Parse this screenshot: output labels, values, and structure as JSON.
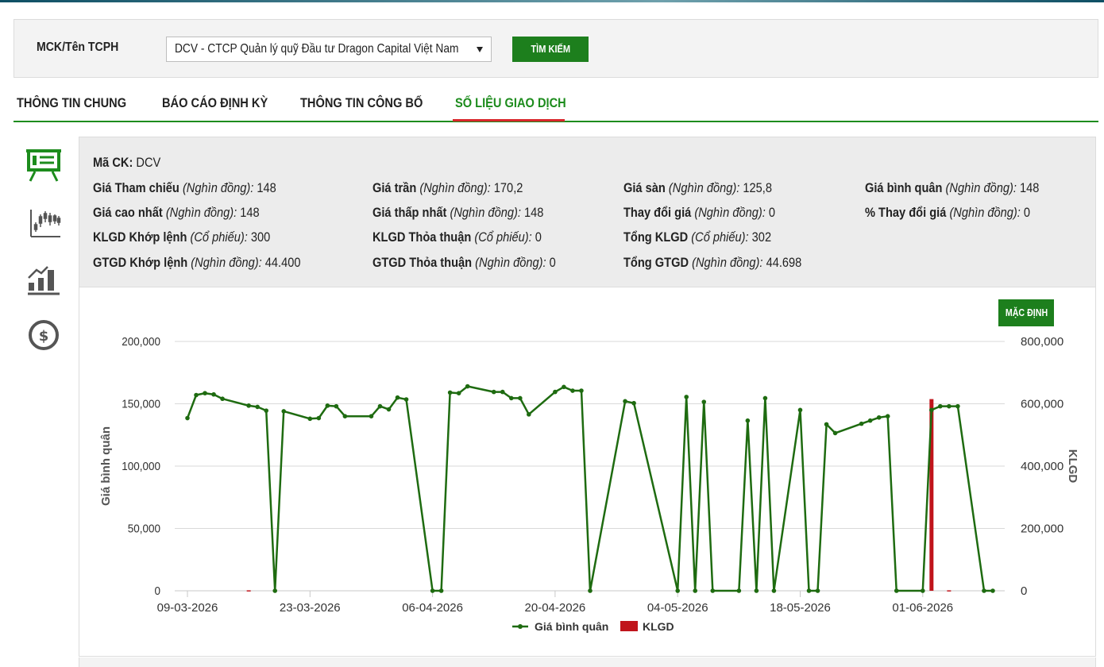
{
  "search": {
    "label": "MCK/Tên TCPH",
    "selected": "DCV - CTCP Quản lý quỹ Đầu tư Dragon Capital Việt Nam",
    "button": "TÌM KIẾM"
  },
  "tabs": [
    {
      "label": "THÔNG TIN CHUNG",
      "active": false
    },
    {
      "label": "BÁO CÁO ĐỊNH KỲ",
      "active": false
    },
    {
      "label": "THÔNG TIN CÔNG BỐ",
      "active": false
    },
    {
      "label": "SỐ LIỆU GIAO DỊCH",
      "active": true
    }
  ],
  "side_icons": [
    "presentation-icon",
    "candlestick-chart-icon",
    "bar-growth-icon",
    "dollar-coin-icon"
  ],
  "colors": {
    "accent": "#1d8c1d",
    "active_tab_underline": "#d9262b",
    "line": "#1e6b10",
    "volume": "#c0141b"
  },
  "info": {
    "code_label": "Mã CK:",
    "code_value": "DCV",
    "rows": [
      [
        {
          "label": "Giá Tham chiếu",
          "unit": "(Nghìn đồng):",
          "value": "148"
        },
        {
          "label": "Giá trần",
          "unit": "(Nghìn đồng):",
          "value": "170,2"
        },
        {
          "label": "Giá sàn",
          "unit": "(Nghìn đồng):",
          "value": "125,8"
        },
        {
          "label": "Giá bình quân",
          "unit": "(Nghìn đồng):",
          "value": "148"
        }
      ],
      [
        {
          "label": "Giá cao nhất",
          "unit": "(Nghìn đồng):",
          "value": "148"
        },
        {
          "label": "Giá thấp nhất",
          "unit": "(Nghìn đồng):",
          "value": "148"
        },
        {
          "label": "Thay đổi giá",
          "unit": "(Nghìn đồng):",
          "value": "0"
        },
        {
          "label": "% Thay đổi giá",
          "unit": "(Nghìn đồng):",
          "value": "0"
        }
      ],
      [
        {
          "label": "KLGD Khớp lệnh",
          "unit": "(Cổ phiếu):",
          "value": "300"
        },
        {
          "label": "KLGD Thỏa thuận",
          "unit": "(Cổ phiếu):",
          "value": "0"
        },
        {
          "label": "Tổng KLGD",
          "unit": "(Cổ phiếu):",
          "value": "302"
        }
      ],
      [
        {
          "label": "GTGD Khớp lệnh",
          "unit": "(Nghìn đồng):",
          "value": "44.400"
        },
        {
          "label": "GTGD Thỏa thuận",
          "unit": "(Nghìn đồng):",
          "value": "0"
        },
        {
          "label": "Tổng GTGD",
          "unit": "(Nghìn đồng):",
          "value": "44.698"
        }
      ]
    ]
  },
  "chart_button": "MẶC ĐỊNH",
  "chart_data": {
    "type": "line",
    "grid": true,
    "legend_position": "bottom-center",
    "ylabel": "Giá bình quân",
    "y2label": "KLGD",
    "ylim": [
      0,
      200000
    ],
    "y2lim": [
      0,
      800000
    ],
    "y_ticks": [
      "0",
      "50,000",
      "100,000",
      "150,000",
      "200,000"
    ],
    "y2_ticks": [
      "0",
      "200,000",
      "400,000",
      "600,000",
      "800,000"
    ],
    "y_tick_values": [
      0,
      50000,
      100000,
      150000,
      200000
    ],
    "xlim": [
      "2026-03-09",
      "2026-06-10"
    ],
    "x_ticks": [
      "09-03-2026",
      "23-03-2026",
      "06-04-2026",
      "20-04-2026",
      "04-05-2026",
      "18-05-2026",
      "01-06-2026"
    ],
    "x_tick_dates": [
      "2026-03-09",
      "2026-03-23",
      "2026-04-06",
      "2026-04-20",
      "2026-05-04",
      "2026-05-18",
      "2026-06-01"
    ],
    "series": [
      {
        "name": "Giá bình quân",
        "axis": "left",
        "points": [
          [
            "2026-03-09",
            138500
          ],
          [
            "2026-03-10",
            157000
          ],
          [
            "2026-03-11",
            158500
          ],
          [
            "2026-03-12",
            157500
          ],
          [
            "2026-03-13",
            154000
          ],
          [
            "2026-03-16",
            148500
          ],
          [
            "2026-03-17",
            147500
          ],
          [
            "2026-03-18",
            144500
          ],
          [
            "2026-03-19",
            0
          ],
          [
            "2026-03-20",
            144000
          ],
          [
            "2026-03-23",
            138000
          ],
          [
            "2026-03-24",
            138500
          ],
          [
            "2026-03-25",
            148500
          ],
          [
            "2026-03-26",
            148000
          ],
          [
            "2026-03-27",
            140000
          ],
          [
            "2026-03-30",
            140000
          ],
          [
            "2026-03-31",
            148000
          ],
          [
            "2026-04-01",
            145500
          ],
          [
            "2026-04-02",
            155000
          ],
          [
            "2026-04-03",
            153500
          ],
          [
            "2026-04-06",
            0
          ],
          [
            "2026-04-07",
            0
          ],
          [
            "2026-04-08",
            159000
          ],
          [
            "2026-04-09",
            158500
          ],
          [
            "2026-04-10",
            164000
          ],
          [
            "2026-04-13",
            159500
          ],
          [
            "2026-04-14",
            159500
          ],
          [
            "2026-04-15",
            154500
          ],
          [
            "2026-04-16",
            154500
          ],
          [
            "2026-04-17",
            141500
          ],
          [
            "2026-04-20",
            159500
          ],
          [
            "2026-04-21",
            163500
          ],
          [
            "2026-04-22",
            160500
          ],
          [
            "2026-04-23",
            160500
          ],
          [
            "2026-04-24",
            0
          ],
          [
            "2026-04-28",
            152000
          ],
          [
            "2026-04-29",
            150500
          ],
          [
            "2026-05-04",
            0
          ],
          [
            "2026-05-05",
            155500
          ],
          [
            "2026-05-06",
            0
          ],
          [
            "2026-05-07",
            151500
          ],
          [
            "2026-05-08",
            0
          ],
          [
            "2026-05-11",
            0
          ],
          [
            "2026-05-12",
            136500
          ],
          [
            "2026-05-13",
            0
          ],
          [
            "2026-05-14",
            154500
          ],
          [
            "2026-05-15",
            0
          ],
          [
            "2026-05-18",
            145000
          ],
          [
            "2026-05-19",
            0
          ],
          [
            "2026-05-20",
            0
          ],
          [
            "2026-05-21",
            133500
          ],
          [
            "2026-05-22",
            126500
          ],
          [
            "2026-05-25",
            134000
          ],
          [
            "2026-05-26",
            136500
          ],
          [
            "2026-05-27",
            139000
          ],
          [
            "2026-05-28",
            140000
          ],
          [
            "2026-05-29",
            0
          ],
          [
            "2026-06-01",
            0
          ],
          [
            "2026-06-02",
            145000
          ],
          [
            "2026-06-03",
            148000
          ],
          [
            "2026-06-04",
            148000
          ],
          [
            "2026-06-05",
            148000
          ],
          [
            "2026-06-08",
            0
          ],
          [
            "2026-06-09",
            0
          ]
        ]
      },
      {
        "name": "KLGD",
        "axis": "right",
        "type": "bar",
        "points": [
          [
            "2026-03-16",
            1500
          ],
          [
            "2026-06-02",
            615000
          ],
          [
            "2026-06-04",
            1500
          ]
        ]
      }
    ]
  }
}
